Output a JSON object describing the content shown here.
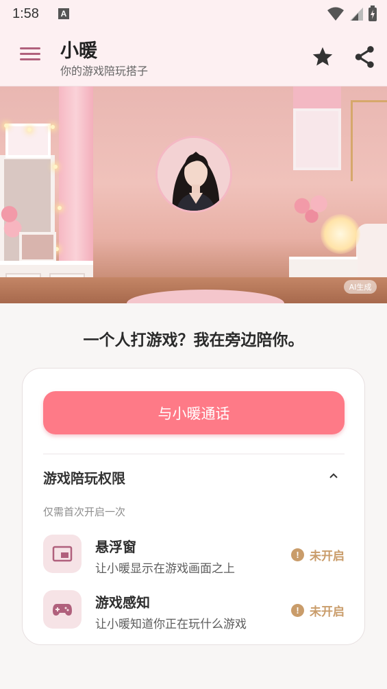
{
  "status_bar": {
    "time": "1:58",
    "notification_icon": "A"
  },
  "app_bar": {
    "title": "小暖",
    "subtitle": "你的游戏陪玩搭子",
    "icons": [
      "menu-icon",
      "star-icon",
      "share-icon"
    ]
  },
  "hero": {
    "ai_badge": "AI生成"
  },
  "tagline": "一个人打游戏？我在旁边陪你。",
  "card": {
    "call_button_label": "与小暖通话",
    "permissions": {
      "title": "游戏陪玩权限",
      "note": "仅需首次开启一次",
      "items": [
        {
          "icon": "picture-in-picture-icon",
          "name": "悬浮窗",
          "description": "让小暖显示在游戏画面之上",
          "status": "未开启"
        },
        {
          "icon": "gamepad-icon",
          "name": "游戏感知",
          "description": "让小暖知道你正在玩什么游戏",
          "status": "未开启"
        }
      ]
    }
  },
  "colors": {
    "accent": "#fe7a87",
    "header_bg": "#fdf0f2",
    "warning": "#c99c6a",
    "menu_icon": "#b0607c"
  }
}
